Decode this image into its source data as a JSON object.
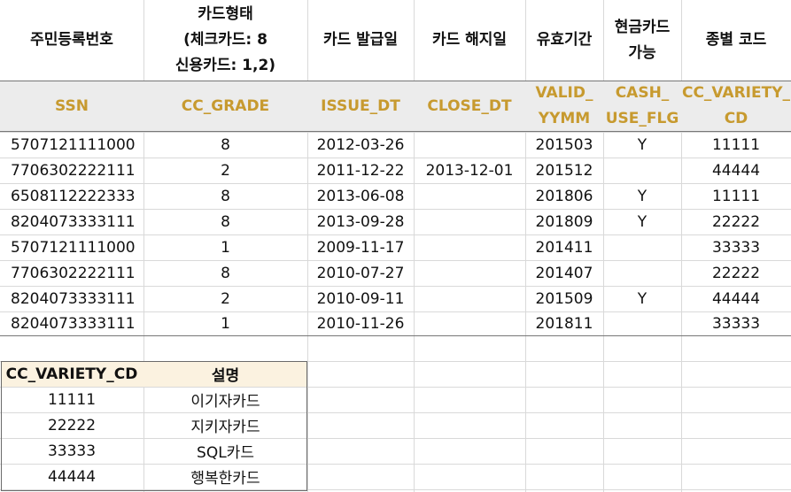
{
  "headers_kr": [
    "주민등록번호",
    [
      "카드형태",
      "(체크카드: 8",
      "신용카드: 1,2)"
    ],
    "카드 발급일",
    "카드 해지일",
    "유효기간",
    [
      "현금카드",
      "가능"
    ],
    "종별 코드"
  ],
  "headers_en": [
    [
      "SSN"
    ],
    [
      "CC_GRADE"
    ],
    [
      "ISSUE_DT"
    ],
    [
      "CLOSE_DT"
    ],
    [
      "VALID_",
      "YYMM"
    ],
    [
      "CASH_",
      "USE_FLG"
    ],
    [
      "CC_VARIETY_",
      "CD"
    ]
  ],
  "rows": [
    [
      "5707121111000",
      "8",
      "2012-03-26",
      "",
      "201503",
      "Y",
      "11111"
    ],
    [
      "7706302222111",
      "2",
      "2011-12-22",
      "2013-12-01",
      "201512",
      "",
      "44444"
    ],
    [
      "6508112222333",
      "8",
      "2013-06-08",
      "",
      "201806",
      "Y",
      "11111"
    ],
    [
      "8204073333111",
      "8",
      "2013-09-28",
      "",
      "201809",
      "Y",
      "22222"
    ],
    [
      "5707121111000",
      "1",
      "2009-11-17",
      "",
      "201411",
      "",
      "33333"
    ],
    [
      "7706302222111",
      "8",
      "2010-07-27",
      "",
      "201407",
      "",
      "22222"
    ],
    [
      "8204073333111",
      "2",
      "2010-09-11",
      "",
      "201509",
      "Y",
      "44444"
    ],
    [
      "8204073333111",
      "1",
      "2010-11-26",
      "",
      "201811",
      "",
      "33333"
    ]
  ],
  "lookup": {
    "headers": [
      "CC_VARIETY_CD",
      "설명"
    ],
    "rows": [
      [
        "11111",
        "이기자카드"
      ],
      [
        "22222",
        "지키자카드"
      ],
      [
        "33333",
        "SQL카드"
      ],
      [
        "44444",
        "행복한카드"
      ]
    ]
  },
  "colors": {
    "header_en": "#c79a2f",
    "header_band": "#ececec",
    "lookup_header": "#fbf2e0",
    "grid": "#d9d9d9"
  }
}
